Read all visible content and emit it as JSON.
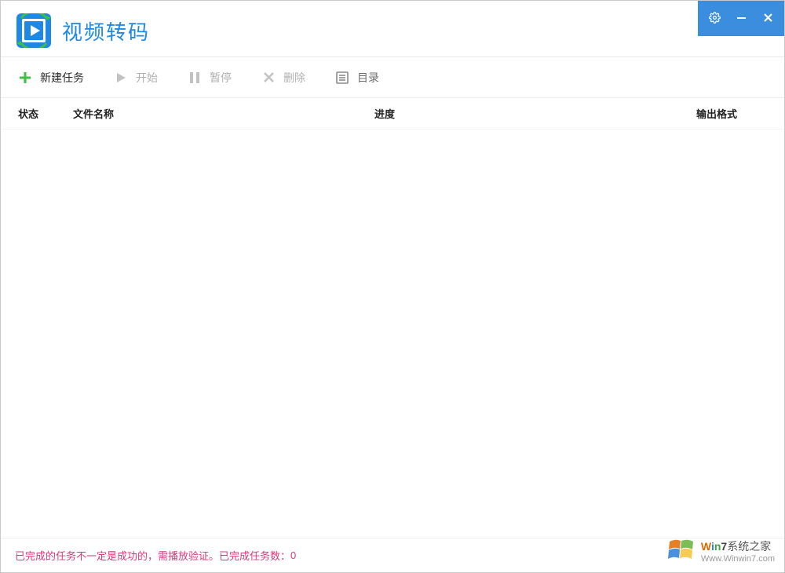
{
  "app": {
    "title": "视频转码"
  },
  "window_controls": {
    "settings": "settings",
    "minimize": "minimize",
    "close": "close"
  },
  "toolbar": {
    "new_task": "新建任务",
    "start": "开始",
    "pause": "暂停",
    "delete": "删除",
    "directory": "目录"
  },
  "columns": {
    "status": "状态",
    "filename": "文件名称",
    "progress": "进度",
    "output_format": "输出格式"
  },
  "status": {
    "message": "已完成的任务不一定是成功的，需播放验证。已完成任务数：",
    "completed_count": "0"
  },
  "watermark": {
    "title": "Win7系统之家",
    "url": "Www.Winwin7.com"
  }
}
